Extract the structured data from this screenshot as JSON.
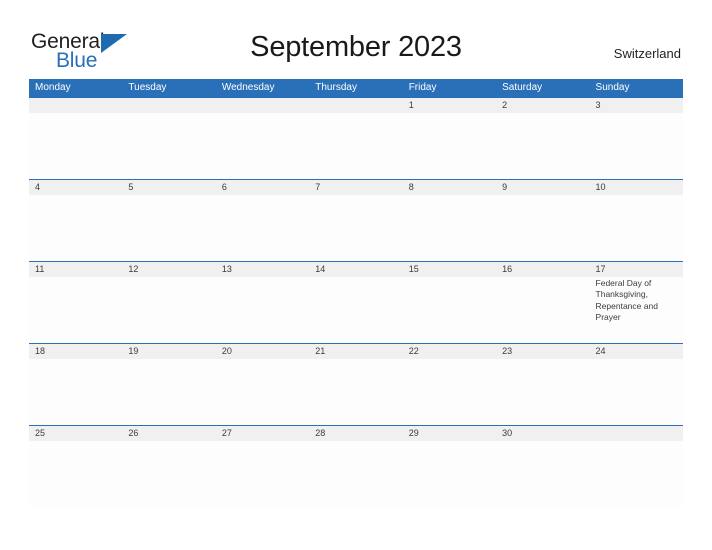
{
  "brand": {
    "name_part1": "General",
    "name_part2": "Blue",
    "logo_icon": "triangle-flag-icon"
  },
  "header": {
    "title": "September 2023",
    "region": "Switzerland"
  },
  "calendar": {
    "weekdays": [
      "Monday",
      "Tuesday",
      "Wednesday",
      "Thursday",
      "Friday",
      "Saturday",
      "Sunday"
    ],
    "weeks": [
      [
        {
          "date": "",
          "event": ""
        },
        {
          "date": "",
          "event": ""
        },
        {
          "date": "",
          "event": ""
        },
        {
          "date": "",
          "event": ""
        },
        {
          "date": "1",
          "event": ""
        },
        {
          "date": "2",
          "event": ""
        },
        {
          "date": "3",
          "event": ""
        }
      ],
      [
        {
          "date": "4",
          "event": ""
        },
        {
          "date": "5",
          "event": ""
        },
        {
          "date": "6",
          "event": ""
        },
        {
          "date": "7",
          "event": ""
        },
        {
          "date": "8",
          "event": ""
        },
        {
          "date": "9",
          "event": ""
        },
        {
          "date": "10",
          "event": ""
        }
      ],
      [
        {
          "date": "11",
          "event": ""
        },
        {
          "date": "12",
          "event": ""
        },
        {
          "date": "13",
          "event": ""
        },
        {
          "date": "14",
          "event": ""
        },
        {
          "date": "15",
          "event": ""
        },
        {
          "date": "16",
          "event": ""
        },
        {
          "date": "17",
          "event": "Federal Day of Thanksgiving, Repentance and Prayer"
        }
      ],
      [
        {
          "date": "18",
          "event": ""
        },
        {
          "date": "19",
          "event": ""
        },
        {
          "date": "20",
          "event": ""
        },
        {
          "date": "21",
          "event": ""
        },
        {
          "date": "22",
          "event": ""
        },
        {
          "date": "23",
          "event": ""
        },
        {
          "date": "24",
          "event": ""
        }
      ],
      [
        {
          "date": "25",
          "event": ""
        },
        {
          "date": "26",
          "event": ""
        },
        {
          "date": "27",
          "event": ""
        },
        {
          "date": "28",
          "event": ""
        },
        {
          "date": "29",
          "event": ""
        },
        {
          "date": "30",
          "event": ""
        },
        {
          "date": "",
          "event": ""
        }
      ]
    ]
  },
  "colors": {
    "header_blue": "#2a70b8",
    "date_band_gray": "#f0f0f0",
    "brand_blue": "#2a70b8",
    "text_dark": "#231f20"
  }
}
